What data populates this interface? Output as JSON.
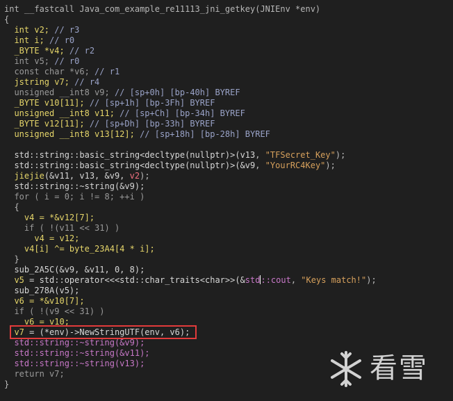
{
  "editor": {
    "lines": [
      [
        {
          "t": "int __fastcall Java_com_example_re11113_jni_getkey(JNIEnv *env)",
          "c": "t-kw"
        }
      ],
      [
        {
          "t": "{",
          "c": "t-sym"
        }
      ],
      [
        {
          "t": "  ",
          "c": "t-plain"
        },
        {
          "t": "int v2;",
          "c": "t-type"
        },
        {
          "t": " // r3",
          "c": "t-cmt"
        }
      ],
      [
        {
          "t": "  ",
          "c": "t-plain"
        },
        {
          "t": "int i;",
          "c": "t-type"
        },
        {
          "t": " // r0",
          "c": "t-cmt"
        }
      ],
      [
        {
          "t": "  ",
          "c": "t-plain"
        },
        {
          "t": "_BYTE *v4;",
          "c": "t-type"
        },
        {
          "t": " // r2",
          "c": "t-cmt"
        }
      ],
      [
        {
          "t": "  ",
          "c": "t-plain"
        },
        {
          "t": "int v5;",
          "c": "t-muted"
        },
        {
          "t": " // r0",
          "c": "t-cmt"
        }
      ],
      [
        {
          "t": "  ",
          "c": "t-plain"
        },
        {
          "t": "const char *v6;",
          "c": "t-muted"
        },
        {
          "t": " // r1",
          "c": "t-cmt"
        }
      ],
      [
        {
          "t": "  ",
          "c": "t-plain"
        },
        {
          "t": "jstring v7;",
          "c": "t-type"
        },
        {
          "t": " // r4",
          "c": "t-cmt"
        }
      ],
      [
        {
          "t": "  ",
          "c": "t-plain"
        },
        {
          "t": "unsigned __int8 v9;",
          "c": "t-muted"
        },
        {
          "t": " // [sp+0h] [bp-40h] BYREF",
          "c": "t-cmt"
        }
      ],
      [
        {
          "t": "  ",
          "c": "t-plain"
        },
        {
          "t": "_BYTE v10[11];",
          "c": "t-type"
        },
        {
          "t": " // [sp+1h] [bp-3Fh] BYREF",
          "c": "t-cmt"
        }
      ],
      [
        {
          "t": "  ",
          "c": "t-plain"
        },
        {
          "t": "unsigned __int8 v11;",
          "c": "t-type"
        },
        {
          "t": " // [sp+Ch] [bp-34h] BYREF",
          "c": "t-cmt"
        }
      ],
      [
        {
          "t": "  ",
          "c": "t-plain"
        },
        {
          "t": "_BYTE v12[11];",
          "c": "t-type"
        },
        {
          "t": " // [sp+Dh] [bp-33h] BYREF",
          "c": "t-cmt"
        }
      ],
      [
        {
          "t": "  ",
          "c": "t-plain"
        },
        {
          "t": "unsigned __int8 v13[12];",
          "c": "t-type"
        },
        {
          "t": " // [sp+18h] [bp-28h] BYREF",
          "c": "t-cmt"
        }
      ],
      [
        {
          "t": "",
          "c": "t-plain"
        }
      ],
      [
        {
          "t": "  std::string::basic_string<decltype(nullptr)>(",
          "c": "t-func"
        },
        {
          "t": "v13",
          "c": "t-param"
        },
        {
          "t": ", ",
          "c": "t-sym"
        },
        {
          "t": "\"TFSecret_Key\"",
          "c": "t-str"
        },
        {
          "t": ");",
          "c": "t-sym"
        }
      ],
      [
        {
          "t": "  std::string::basic_string<decltype(nullptr)>(",
          "c": "t-func"
        },
        {
          "t": "&v9",
          "c": "t-param"
        },
        {
          "t": ", ",
          "c": "t-sym"
        },
        {
          "t": "\"YourRC4Key\"",
          "c": "t-str"
        },
        {
          "t": ");",
          "c": "t-sym"
        }
      ],
      [
        {
          "t": "  ",
          "c": "t-plain"
        },
        {
          "t": "jiejie",
          "c": "t-type"
        },
        {
          "t": "(&v11, v13, &v9, ",
          "c": "t-func"
        },
        {
          "t": "v2",
          "c": "t-neg"
        },
        {
          "t": ");",
          "c": "t-sym"
        }
      ],
      [
        {
          "t": "  std::string::~string(&v9);",
          "c": "t-func"
        }
      ],
      [
        {
          "t": "  ",
          "c": "t-plain"
        },
        {
          "t": "for ( i = 0; i != 8; ++i )",
          "c": "t-muted"
        }
      ],
      [
        {
          "t": "  {",
          "c": "t-sym"
        }
      ],
      [
        {
          "t": "    ",
          "c": "t-plain"
        },
        {
          "t": "v4 = *&v12[7];",
          "c": "t-type"
        }
      ],
      [
        {
          "t": "    ",
          "c": "t-plain"
        },
        {
          "t": "if ( !(v11 << 31) )",
          "c": "t-muted"
        }
      ],
      [
        {
          "t": "      ",
          "c": "t-plain"
        },
        {
          "t": "v4 = v12;",
          "c": "t-type"
        }
      ],
      [
        {
          "t": "    ",
          "c": "t-plain"
        },
        {
          "t": "v4[i] ^= byte_23A4[4 * i];",
          "c": "t-type"
        }
      ],
      [
        {
          "t": "  }",
          "c": "t-sym"
        }
      ],
      [
        {
          "t": "  sub_2A5C(&v9, &v11, 0, 8);",
          "c": "t-func"
        }
      ],
      [
        {
          "t": "  ",
          "c": "t-plain"
        },
        {
          "t": "v5",
          "c": "t-type"
        },
        {
          "t": " = std::operator<<<std::char_traits<char>>(&",
          "c": "t-func"
        },
        {
          "t": "std",
          "c": "t-lib"
        },
        {
          "t": "CURSOR",
          "c": "cursor"
        },
        {
          "t": "::cout",
          "c": "t-lib"
        },
        {
          "t": ", ",
          "c": "t-sym"
        },
        {
          "t": "\"Keys match!\"",
          "c": "t-str"
        },
        {
          "t": ");",
          "c": "t-sym"
        }
      ],
      [
        {
          "t": "  sub_278A(v5);",
          "c": "t-func"
        }
      ],
      [
        {
          "t": "  ",
          "c": "t-plain"
        },
        {
          "t": "v6 = *&v10[7];",
          "c": "t-type"
        }
      ],
      [
        {
          "t": "  ",
          "c": "t-plain"
        },
        {
          "t": "if ( !(v9 << 31) )",
          "c": "t-muted"
        }
      ],
      [
        {
          "t": "    ",
          "c": "t-plain"
        },
        {
          "t": "v6 = v10;",
          "c": "t-type"
        }
      ],
      [
        {
          "t": "  ",
          "c": "t-plain"
        },
        {
          "t": "v7",
          "c": "t-type"
        },
        {
          "t": " = (*env)->NewStringUTF(env, v6);",
          "c": "t-func"
        }
      ],
      [
        {
          "t": "  std::string::~string(&v9);",
          "c": "t-lib"
        }
      ],
      [
        {
          "t": "  std::string::~string(&v11);",
          "c": "t-lib"
        }
      ],
      [
        {
          "t": "  std::string::~string(v13);",
          "c": "t-lib"
        }
      ],
      [
        {
          "t": "  return v7;",
          "c": "t-muted"
        }
      ],
      [
        {
          "t": "}",
          "c": "t-sym"
        }
      ]
    ]
  },
  "watermark": {
    "text": "看雪",
    "icon": "snowflake-icon",
    "color": "#e6e6e6"
  },
  "colors": {
    "background": "#1f1f1f",
    "highlight_border": "#e23b3b"
  }
}
